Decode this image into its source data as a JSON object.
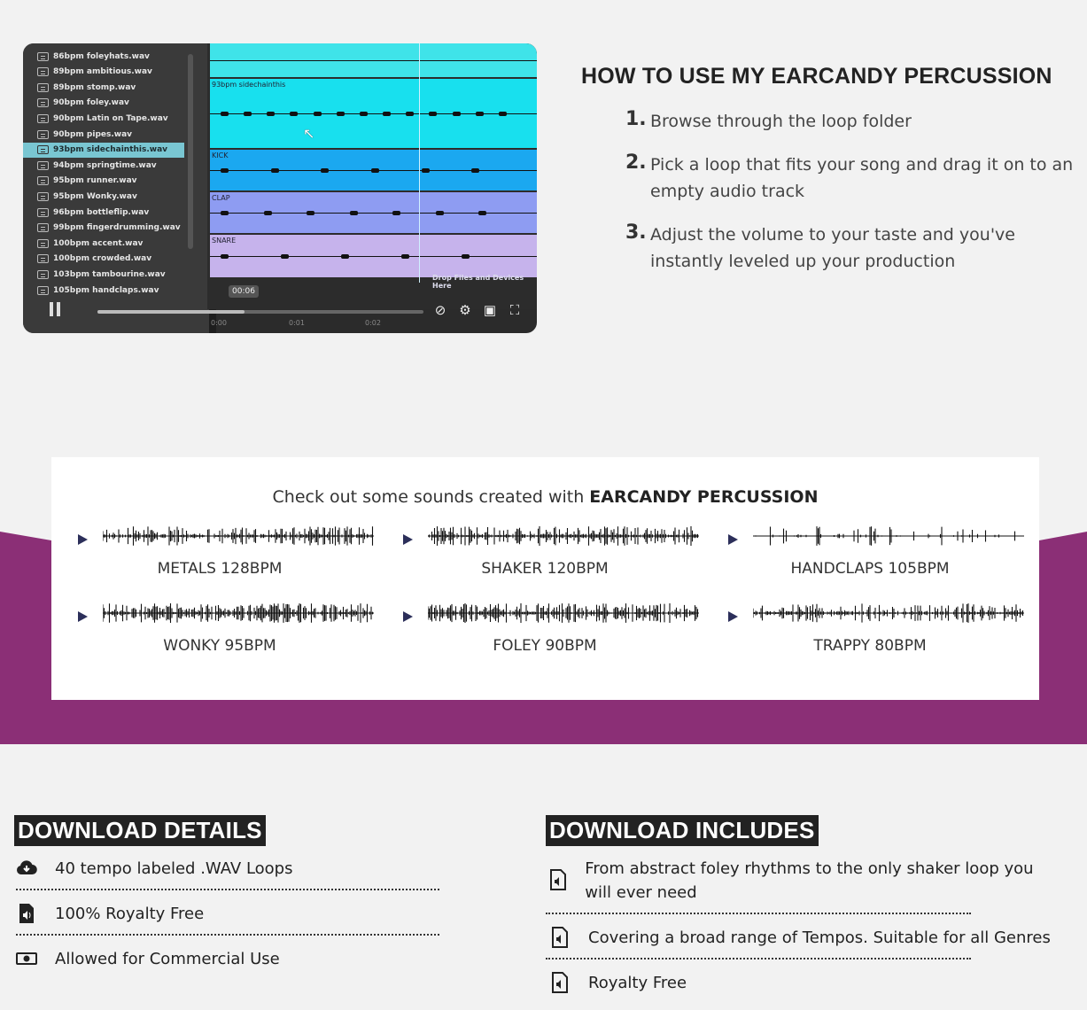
{
  "video": {
    "files": [
      "86bpm foleyhats.wav",
      "89bpm ambitious.wav",
      "89bpm stomp.wav",
      "90bpm foley.wav",
      "90bpm Latin on Tape.wav",
      "90bpm pipes.wav",
      "93bpm sidechainthis.wav",
      "94bpm springtime.wav",
      "95bpm runner.wav",
      "95bpm Wonky.wav",
      "96bpm bottleflip.wav",
      "99bpm fingerdrumming.wav",
      "100bpm accent.wav",
      "100bpm crowded.wav",
      "103bpm tambourine.wav",
      "105bpm handclaps.wav"
    ],
    "selected_index": 6,
    "lanes": [
      {
        "label": "",
        "color": "#3fe3e9"
      },
      {
        "label": "93bpm sidechainthis",
        "color": "#18e0ee"
      },
      {
        "label": "KICK",
        "color": "#1ba8f0"
      },
      {
        "label": "CLAP",
        "color": "#8e9cf2"
      },
      {
        "label": "SNARE",
        "color": "#c6b3ec"
      }
    ],
    "drop_text": "Drop Files and Devices Here",
    "time_tooltip": "00:06",
    "progress": 0.45,
    "ticks": [
      "0:00",
      "0:01",
      "0:02"
    ]
  },
  "howto": {
    "title": "HOW TO USE MY EARCANDY PERCUSSION",
    "steps": [
      {
        "num": "1.",
        "text": "Browse through the loop folder"
      },
      {
        "num": "2.",
        "text": "Pick a loop that fits your song and drag it on to an empty audio track"
      },
      {
        "num": "3.",
        "text": "Adjust the volume to your taste and you've instantly leveled up your production"
      }
    ]
  },
  "sounds": {
    "heading_prefix": "Check out some sounds created with ",
    "heading_bold": "EARCANDY PERCUSSION",
    "players": [
      {
        "name": "METALS 128BPM"
      },
      {
        "name": "SHAKER 120BPM"
      },
      {
        "name": "HANDCLAPS 105BPM"
      },
      {
        "name": "WONKY 95BPM"
      },
      {
        "name": "FOLEY 90BPM"
      },
      {
        "name": "TRAPPY 80BPM"
      }
    ]
  },
  "details": {
    "title": "DOWNLOAD DETAILS",
    "items": [
      {
        "icon": "cloud-download-icon",
        "text": "40 tempo labeled .WAV Loops"
      },
      {
        "icon": "audio-file-icon",
        "text": "100% Royalty Free"
      },
      {
        "icon": "money-bill-icon",
        "text": "Allowed for Commercial Use"
      }
    ]
  },
  "includes": {
    "title": "DOWNLOAD INCLUDES",
    "items": [
      {
        "icon": "audio-file-icon",
        "text": "From abstract foley rhythms to the only shaker loop you will ever need"
      },
      {
        "icon": "audio-file-icon",
        "text": "Covering a broad range of Tempos. Suitable for all Genres"
      },
      {
        "icon": "audio-file-icon",
        "text": "Royalty Free"
      }
    ]
  },
  "colors": {
    "band": "#8b2f76",
    "play": "#2c2f5a"
  }
}
